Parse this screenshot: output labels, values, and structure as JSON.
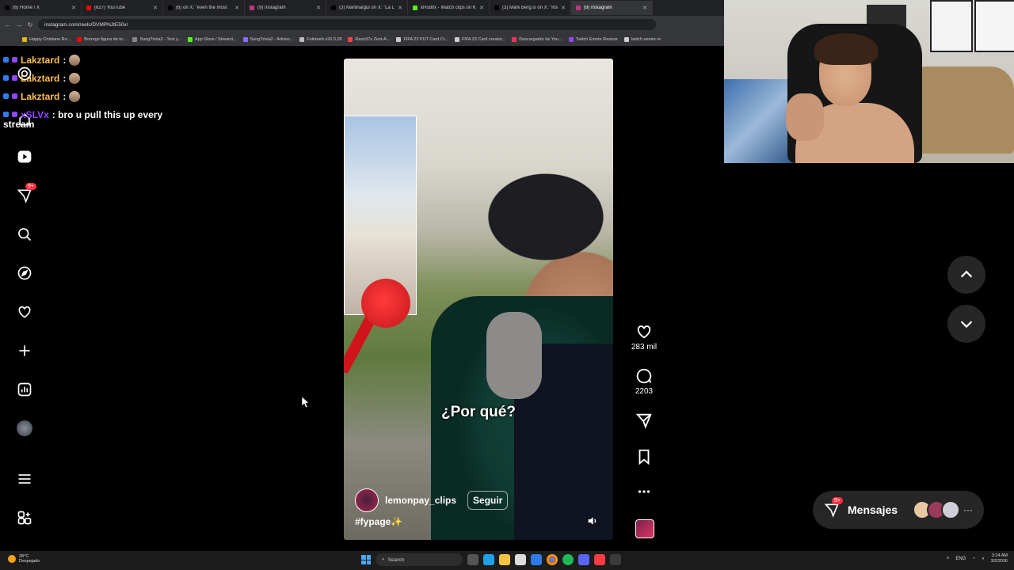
{
  "browser": {
    "tabs": [
      {
        "label": "(6) Home / X",
        "color": "#000000"
      },
      {
        "label": "(627) YouTube",
        "color": "#ff0000"
      },
      {
        "label": "(6) on X: \"even the most",
        "color": "#000000"
      },
      {
        "label": "(9) Instagram",
        "color": "#c13584"
      },
      {
        "label": "(3) MartinaIgui on X: \"La Liga",
        "color": "#000000"
      },
      {
        "label": "xRodifx - Watch clips on Kick",
        "color": "#53fc18"
      },
      {
        "label": "(3) Mark Berg is on X: \"Ins",
        "color": "#000000"
      },
      {
        "label": "(9) Instagram",
        "color": "#c13584"
      }
    ],
    "url": "instagram.com/reels/DVMPNJtE50x/",
    "bookmarks": [
      {
        "label": "Happy Cristiano Ro...",
        "color": "#e6b800"
      },
      {
        "label": "Borrego figura de to...",
        "color": "#ff0000"
      },
      {
        "label": "SongTrivia2 - Test y...",
        "color": "#888888"
      },
      {
        "label": "App Store / Streami...",
        "color": "#53fc18"
      },
      {
        "label": "SongTrivia2 - Advivn...",
        "color": "#8a6cff"
      },
      {
        "label": "Foleteeb v26.0.28",
        "color": "#bbbbbb"
      },
      {
        "label": "Razo97s Zest-A...",
        "color": "#ff4444"
      },
      {
        "label": "FIFA 23 PUT Card Cr...",
        "color": "#cccccc"
      },
      {
        "label": "FIFA 23 Card creator...",
        "color": "#cccccc"
      },
      {
        "label": "Descargador de You...",
        "color": "#ff3355"
      },
      {
        "label": "Twitch Emote Resizer",
        "color": "#9146ff"
      },
      {
        "label": "twitch emote re",
        "color": "#cccccc"
      }
    ]
  },
  "chat": [
    {
      "user": "Lakztard",
      "message": ":",
      "color": "#ffc04d"
    },
    {
      "user": "Lakztard",
      "message": ":",
      "color": "#ffc04d"
    },
    {
      "user": "Lakztard",
      "message": ":",
      "color": "#ffc04d"
    },
    {
      "user": "xSLVx",
      "message": ": bro u pull this up every",
      "color": "#9146ff"
    }
  ],
  "chat_wrap": "stream",
  "sidebar": {
    "items": [
      "home-icon",
      "reels-icon",
      "messages-icon",
      "search-icon",
      "explore-icon",
      "heart-icon",
      "create-icon",
      "dashboard-icon",
      "profile-avatar",
      "menu-icon",
      "more-icon"
    ],
    "messages_badge": "9+"
  },
  "reel": {
    "caption": "¿Por qué?",
    "username": "lemonpay_clips",
    "follow_label": "Seguir",
    "hashtag": "#fypage✨",
    "likes": "283 mil",
    "comments": "2203"
  },
  "messages": {
    "label": "Mensajes",
    "badge": "9+"
  },
  "taskbar": {
    "temp": "28°C",
    "weather": "Despejado",
    "search": "Search",
    "lang": "ENG",
    "time": "3:24 AM",
    "date": "3/2/2026"
  },
  "colors": {
    "accent_red": "#ff3040",
    "ig_dark": "#262626"
  }
}
